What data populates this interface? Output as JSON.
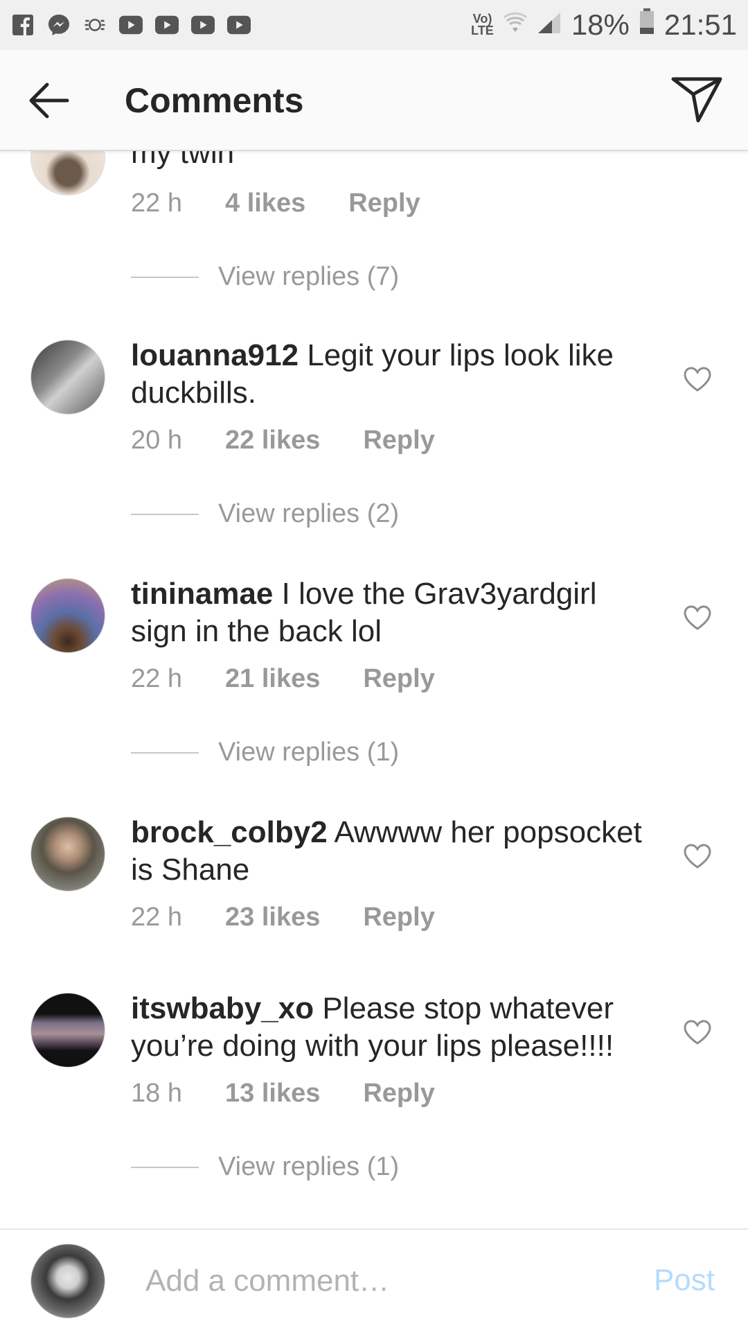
{
  "status_bar": {
    "left_icons": [
      "facebook-icon",
      "messenger-icon",
      "sync-icon",
      "youtube-icon",
      "youtube-icon",
      "youtube-icon",
      "youtube-icon"
    ],
    "network_top": "Vo)",
    "network_bottom": "LTE",
    "battery": "18%",
    "time": "21:51"
  },
  "header": {
    "title": "Comments"
  },
  "comments": [
    {
      "username": "",
      "text": "my twin",
      "time": "22 h",
      "likes": "4 likes",
      "reply": "Reply",
      "view_replies": "View replies (7)"
    },
    {
      "username": "louanna912",
      "text": " Legit your lips look like duckbills.",
      "time": "20 h",
      "likes": "22 likes",
      "reply": "Reply",
      "view_replies": "View replies (2)"
    },
    {
      "username": "tininamae",
      "text": " I love the Grav3yardgirl sign in the back lol",
      "time": "22 h",
      "likes": "21 likes",
      "reply": "Reply",
      "view_replies": "View replies (1)"
    },
    {
      "username": "brock_colby2",
      "text": " Awwww her popsocket is Shane",
      "time": "22 h",
      "likes": "23 likes",
      "reply": "Reply",
      "view_replies": ""
    },
    {
      "username": "itswbaby_xo",
      "text": " Please stop whatever you’re doing with your lips please!!!!",
      "time": "18 h",
      "likes": "13 likes",
      "reply": "Reply",
      "view_replies": "View replies (1)"
    }
  ],
  "composer": {
    "placeholder": "Add a comment…",
    "post_label": "Post"
  },
  "colors": {
    "text": "#262626",
    "meta": "#999999",
    "post_disabled": "#b3dbff",
    "header_bg": "#fafafa",
    "status_bg": "#f0f0f0"
  }
}
